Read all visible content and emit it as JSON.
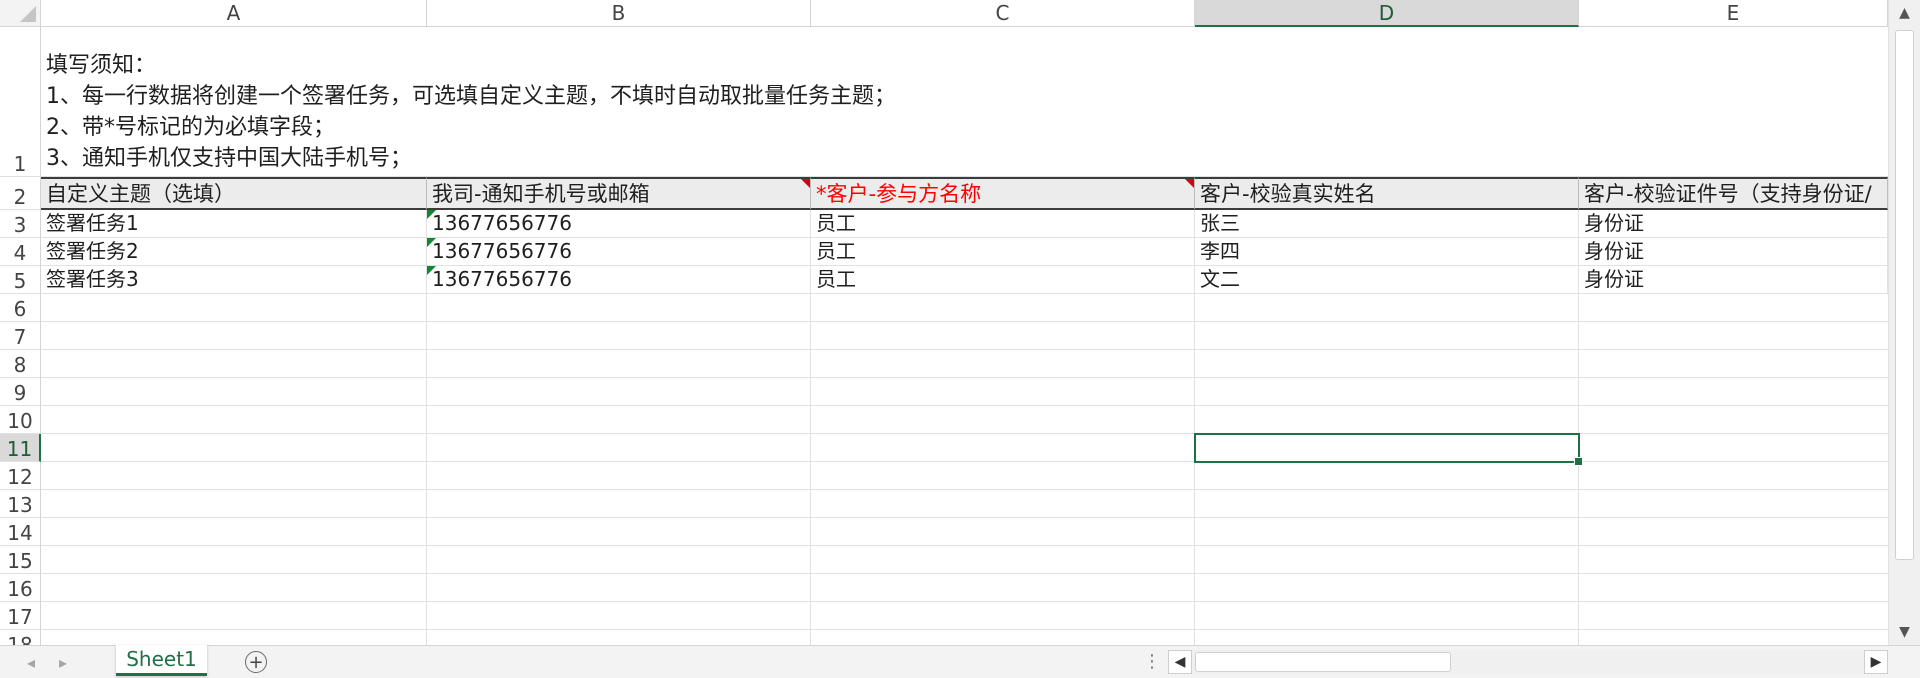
{
  "columns": [
    {
      "letter": "A",
      "active": false
    },
    {
      "letter": "B",
      "active": false
    },
    {
      "letter": "C",
      "active": false
    },
    {
      "letter": "D",
      "active": true
    },
    {
      "letter": "E",
      "active": false
    }
  ],
  "rows": [
    "1",
    "2",
    "3",
    "4",
    "5",
    "6",
    "7",
    "8",
    "9",
    "10",
    "11",
    "12",
    "13",
    "14",
    "15",
    "16",
    "17",
    "18"
  ],
  "active_row": "11",
  "instructions": "填写须知：\n1、每一行数据将创建一个签署任务，可选填自定义主题，不填时自动取批量任务主题；\n2、带*号标记的为必填字段；\n3、通知手机仅支持中国大陆手机号；",
  "headers": [
    "自定义主题（选填）",
    "我司-通知手机号或邮箱",
    "*客户-参与方名称",
    "客户-校验真实姓名",
    "客户-校验证件号（支持身份证/"
  ],
  "data_rows": [
    [
      "签署任务1",
      "13677656776",
      "员工",
      "张三",
      "身份证"
    ],
    [
      "签署任务2",
      "13677656776",
      "员工",
      "李四",
      "身份证"
    ],
    [
      "签署任务3",
      "13677656776",
      "员工",
      "文二",
      "身份证"
    ]
  ],
  "sheet_tab": "Sheet1",
  "add_sheet_icon": "+",
  "colors": {
    "accent": "#1e7145",
    "required_header": "#ff0000",
    "note_marker": "#d0021b"
  }
}
